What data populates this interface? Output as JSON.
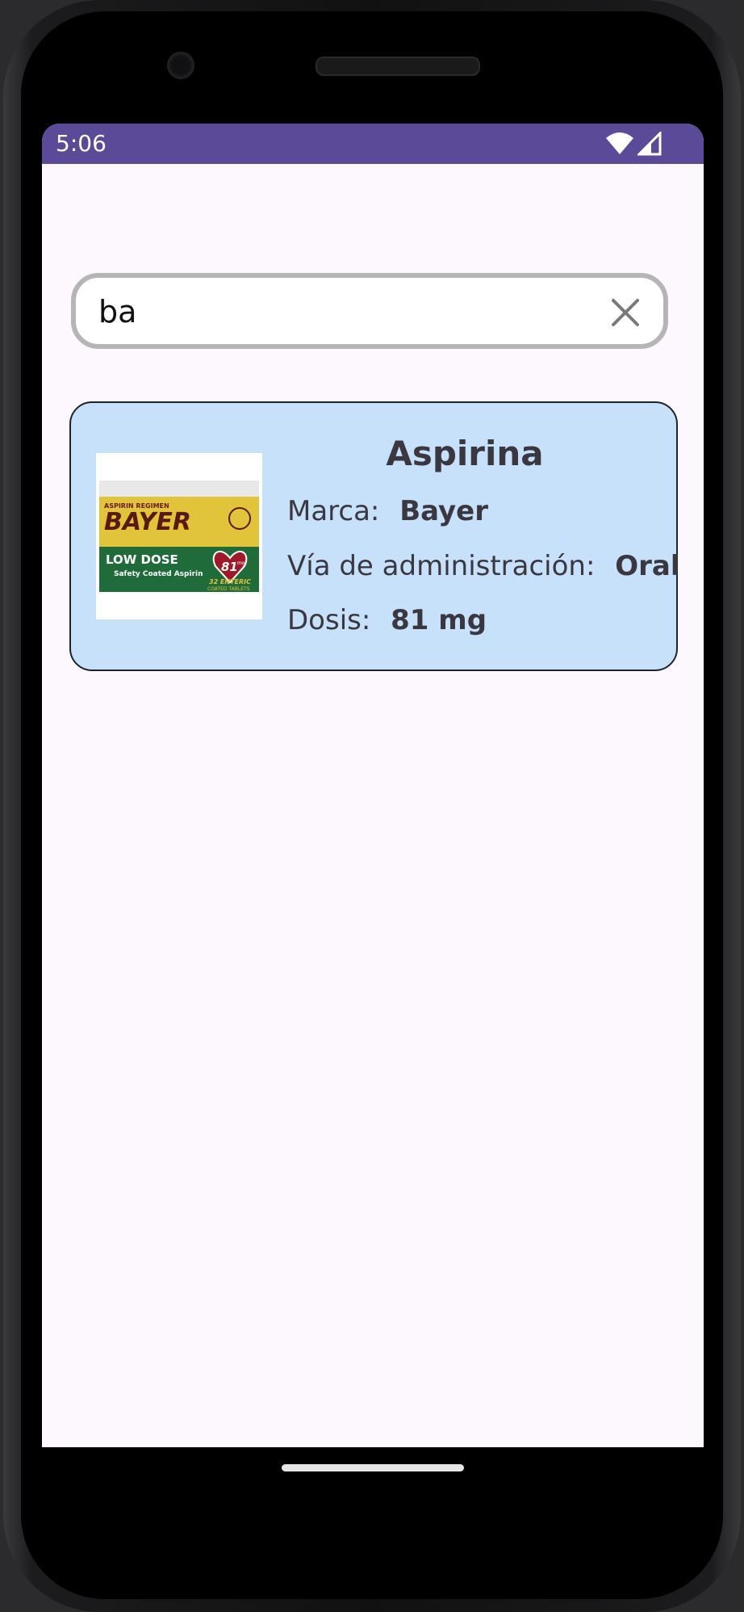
{
  "status_bar": {
    "time": "5:06",
    "icons": [
      "wifi-icon",
      "signal-icon"
    ],
    "color": "#5b4a98"
  },
  "search": {
    "value": "ba",
    "clear_icon": "close-icon"
  },
  "results": [
    {
      "title": "Aspirina",
      "image": {
        "name": "bayer-aspirin-box",
        "brand_text": "BAYER",
        "top_text": "ASPIRIN REGIMEN",
        "dose_text": "LOW DOSE",
        "sub_text": "Safety Coated Aspirin",
        "badge": "81",
        "badge_unit": "mg",
        "count_text": "32 ENTERIC",
        "count_sub": "COATED TABLETS"
      },
      "brand_label": "Marca:",
      "brand_value": "Bayer",
      "route_label": "Vía de administración:",
      "route_value": "Oral",
      "dose_label": "Dosis:",
      "dose_value": "81 mg"
    }
  ],
  "colors": {
    "card_background": "#c7e1fb",
    "screen_background": "#fdf8fd",
    "text": "#3b3740"
  }
}
